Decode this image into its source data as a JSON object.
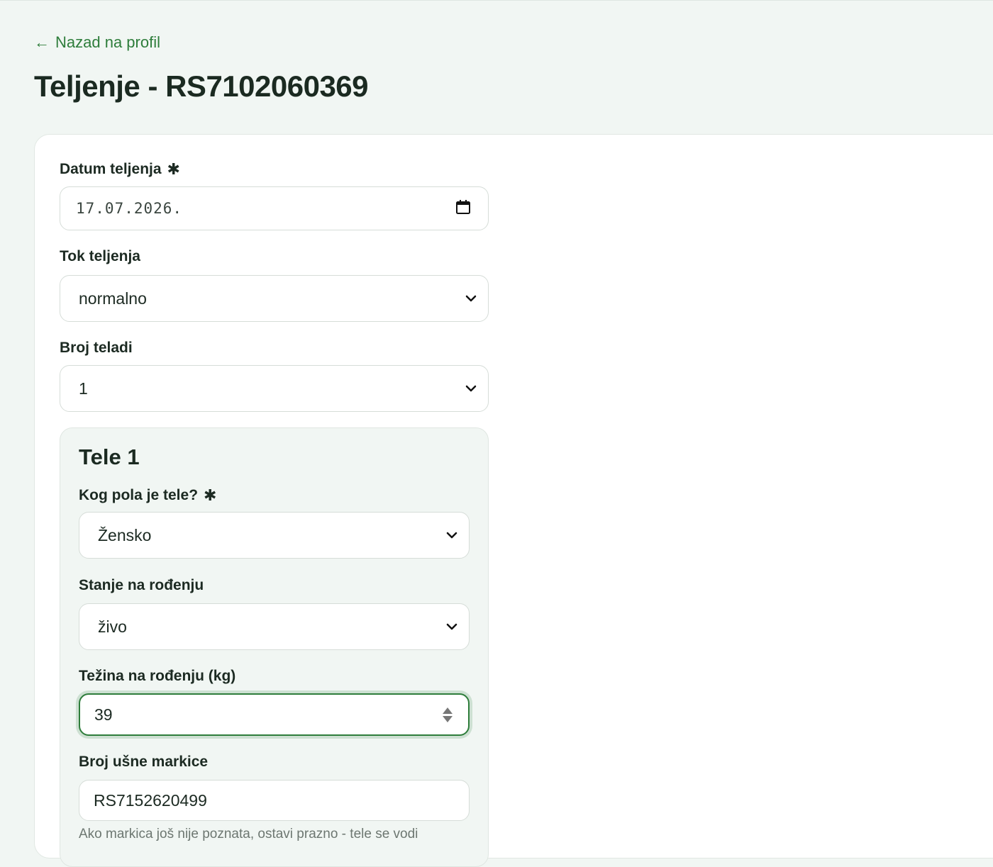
{
  "nav": {
    "back_arrow": "←",
    "back_label": "Nazad na profil"
  },
  "page": {
    "title": "Teljenje - RS7102060369"
  },
  "form": {
    "date": {
      "label": "Datum teljenja",
      "required_mark": "✱",
      "value": "17.07.2026.",
      "icon": "calendar-icon"
    },
    "calving_course": {
      "label": "Tok teljenja",
      "value": "normalno"
    },
    "calf_count": {
      "label": "Broj teladi",
      "value": "1"
    }
  },
  "calves": [
    {
      "title": "Tele 1",
      "sex": {
        "label": "Kog pola je tele?",
        "required_mark": "✱",
        "value": "Žensko"
      },
      "birth_state": {
        "label": "Stanje na rođenju",
        "value": "živo"
      },
      "birth_weight": {
        "label": "Težina na rođenju (kg)",
        "value": "39"
      },
      "ear_tag": {
        "label": "Broj ušne markice",
        "value": "RS7152620499",
        "hint": "Ako markica još nije poznata, ostavi prazno - tele se vodi"
      }
    }
  ],
  "colors": {
    "accent": "#2e7d3b",
    "background": "#f1f6f3",
    "card": "#ffffff",
    "text": "#1c2a22"
  }
}
